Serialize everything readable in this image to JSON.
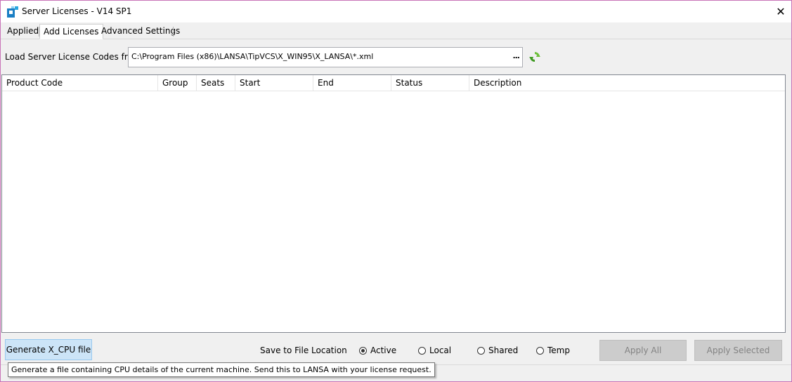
{
  "window": {
    "title": "Server Licenses - V14 SP1",
    "close_glyph": "✕"
  },
  "tabs": [
    {
      "label": "Applied",
      "active": false
    },
    {
      "label": "Add Licenses",
      "active": true
    },
    {
      "label": "Advanced Settings",
      "active": false
    }
  ],
  "load": {
    "label": "Load Server License Codes from",
    "path": "C:\\Program Files (x86)\\LANSA\\TipVCS\\X_WIN95\\X_LANSA\\*.xml",
    "browse_label": "...",
    "refresh_icon": "refresh-icon"
  },
  "grid": {
    "columns": [
      "Product Code",
      "Group",
      "Seats",
      "Start",
      "End",
      "Status",
      "Description"
    ],
    "rows": []
  },
  "footer": {
    "generate_label": "Generate X_CPU file",
    "save_location_label": "Save to File Location",
    "radio_options": [
      {
        "label": "Active",
        "checked": true
      },
      {
        "label": "Local",
        "checked": false
      },
      {
        "label": "Shared",
        "checked": false
      },
      {
        "label": "Temp",
        "checked": false
      }
    ],
    "apply_all_label": "Apply All",
    "apply_selected_label": "Apply Selected"
  },
  "tooltip": "Generate a file containing CPU details of the current machine. Send this to LANSA with your license request.",
  "colors": {
    "window_border": "#c873b8",
    "accent_button": "#cce4f7",
    "disabled_button": "#cccccc",
    "refresh_green": "#4caf50"
  }
}
